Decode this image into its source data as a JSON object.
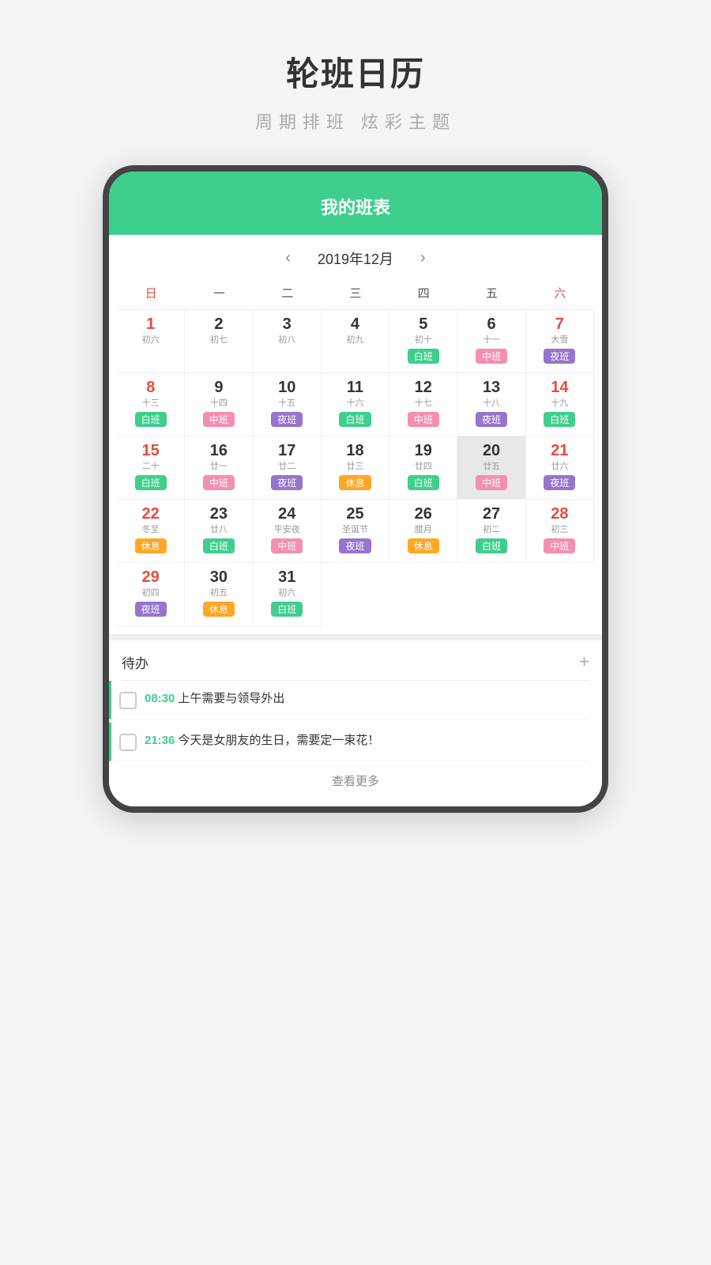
{
  "app": {
    "title": "轮班日历",
    "subtitle": "周期排班  炫彩主题"
  },
  "phone_header": {
    "label": "我的班表"
  },
  "calendar": {
    "month_display": "2019年12月",
    "prev_btn": "‹",
    "next_btn": "›",
    "weekdays": [
      "日",
      "一",
      "二",
      "三",
      "四",
      "五",
      "六"
    ],
    "days": [
      {
        "num": "1",
        "lunar": "初六",
        "shift": "",
        "badge": "",
        "red": true,
        "highlight": false
      },
      {
        "num": "2",
        "lunar": "初七",
        "shift": "",
        "badge": "",
        "red": false,
        "highlight": false
      },
      {
        "num": "3",
        "lunar": "初八",
        "shift": "",
        "badge": "",
        "red": false,
        "highlight": false
      },
      {
        "num": "4",
        "lunar": "初九",
        "shift": "",
        "badge": "",
        "red": false,
        "highlight": false
      },
      {
        "num": "5",
        "lunar": "初十",
        "shift": "白班",
        "badge": "badge-green",
        "red": false,
        "highlight": false
      },
      {
        "num": "6",
        "lunar": "十一",
        "shift": "中班",
        "badge": "badge-pink",
        "red": false,
        "highlight": false
      },
      {
        "num": "7",
        "lunar": "大雪",
        "shift": "夜班",
        "badge": "badge-purple",
        "red": true,
        "highlight": false
      },
      {
        "num": "8",
        "lunar": "十三",
        "shift": "白班",
        "badge": "badge-green",
        "red": true,
        "highlight": false
      },
      {
        "num": "9",
        "lunar": "十四",
        "shift": "中班",
        "badge": "badge-pink",
        "red": false,
        "highlight": false
      },
      {
        "num": "10",
        "lunar": "十五",
        "shift": "夜班",
        "badge": "badge-purple",
        "red": false,
        "highlight": false
      },
      {
        "num": "11",
        "lunar": "十六",
        "shift": "白班",
        "badge": "badge-green",
        "red": false,
        "highlight": false
      },
      {
        "num": "12",
        "lunar": "十七",
        "shift": "中班",
        "badge": "badge-pink",
        "red": false,
        "highlight": false
      },
      {
        "num": "13",
        "lunar": "十八",
        "shift": "夜班",
        "badge": "badge-purple",
        "red": false,
        "highlight": false
      },
      {
        "num": "14",
        "lunar": "十九",
        "shift": "白班",
        "badge": "badge-green",
        "red": true,
        "highlight": false
      },
      {
        "num": "15",
        "lunar": "二十",
        "shift": "白班",
        "badge": "badge-green",
        "red": true,
        "highlight": false
      },
      {
        "num": "16",
        "lunar": "廿一",
        "shift": "中班",
        "badge": "badge-pink",
        "red": false,
        "highlight": false
      },
      {
        "num": "17",
        "lunar": "廿二",
        "shift": "夜班",
        "badge": "badge-purple",
        "red": false,
        "highlight": false
      },
      {
        "num": "18",
        "lunar": "廿三",
        "shift": "休息",
        "badge": "badge-orange",
        "red": false,
        "highlight": false
      },
      {
        "num": "19",
        "lunar": "廿四",
        "shift": "白班",
        "badge": "badge-green",
        "red": false,
        "highlight": false
      },
      {
        "num": "20",
        "lunar": "廿五",
        "shift": "中班",
        "badge": "badge-pink",
        "red": false,
        "highlight": true
      },
      {
        "num": "21",
        "lunar": "廿六",
        "shift": "夜班",
        "badge": "badge-purple",
        "red": true,
        "highlight": false
      },
      {
        "num": "22",
        "lunar": "冬至",
        "shift": "休息",
        "badge": "badge-orange",
        "red": true,
        "highlight": false
      },
      {
        "num": "23",
        "lunar": "廿八",
        "shift": "白班",
        "badge": "badge-green",
        "red": false,
        "highlight": false
      },
      {
        "num": "24",
        "lunar": "平安夜",
        "shift": "中班",
        "badge": "badge-pink",
        "red": false,
        "highlight": false
      },
      {
        "num": "25",
        "lunar": "圣诞节",
        "shift": "夜班",
        "badge": "badge-purple",
        "red": false,
        "highlight": false
      },
      {
        "num": "26",
        "lunar": "腊月",
        "shift": "休息",
        "badge": "badge-orange",
        "red": false,
        "highlight": false
      },
      {
        "num": "27",
        "lunar": "初二",
        "shift": "白班",
        "badge": "badge-green",
        "red": false,
        "highlight": false
      },
      {
        "num": "28",
        "lunar": "初三",
        "shift": "中班",
        "badge": "badge-pink",
        "red": true,
        "highlight": false
      },
      {
        "num": "29",
        "lunar": "初四",
        "shift": "夜班",
        "badge": "badge-purple",
        "red": true,
        "highlight": false
      },
      {
        "num": "30",
        "lunar": "初五",
        "shift": "休息",
        "badge": "badge-orange",
        "red": false,
        "highlight": false
      },
      {
        "num": "31",
        "lunar": "初六",
        "shift": "白班",
        "badge": "badge-green",
        "red": false,
        "highlight": false
      }
    ]
  },
  "todo": {
    "section_title": "待办",
    "add_btn": "+",
    "items": [
      {
        "time": "08:30",
        "text": "上午需要与领导外出"
      },
      {
        "time": "21:36",
        "text": "今天是女朋友的生日，需要定一束花！"
      }
    ],
    "more_label": "查看更多"
  }
}
